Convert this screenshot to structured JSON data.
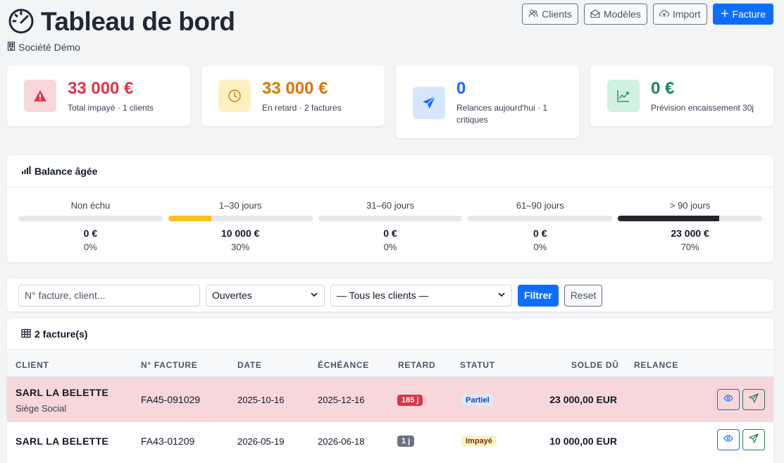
{
  "header": {
    "title": "Tableau de bord",
    "company": "Société Démo",
    "buttons": {
      "clients": "Clients",
      "templates": "Modèles",
      "import": "Import",
      "invoice": "Facture"
    }
  },
  "kpis": [
    {
      "value": "33 000 €",
      "label": "Total impayé · 1 clients",
      "color": "#dc3545",
      "icon": "warning-icon"
    },
    {
      "value": "33 000 €",
      "label": "En retard · 2 factures",
      "color": "#d97706",
      "icon": "clock-icon"
    },
    {
      "value": "0",
      "label": "Relances aujourd'hui · 1 critiques",
      "color": "#0d6efd",
      "icon": "send-icon"
    },
    {
      "value": "0 €",
      "label": "Prévision encaissement 30j",
      "color": "#198754",
      "icon": "trend-up-icon"
    }
  ],
  "aging": {
    "title": "Balance âgée",
    "buckets": [
      {
        "label": "Non échu",
        "amount": "0 €",
        "pct_label": "0%",
        "pct": 0,
        "color": "#e5e7eb"
      },
      {
        "label": "1–30 jours",
        "amount": "10 000 €",
        "pct_label": "30%",
        "pct": 30,
        "color": "#fbbf24"
      },
      {
        "label": "31–60 jours",
        "amount": "0 €",
        "pct_label": "0%",
        "pct": 0,
        "color": "#e5e7eb"
      },
      {
        "label": "61–90 jours",
        "amount": "0 €",
        "pct_label": "0%",
        "pct": 0,
        "color": "#e5e7eb"
      },
      {
        "label": "> 90 jours",
        "amount": "23 000 €",
        "pct_label": "70%",
        "pct": 70,
        "color": "#212529"
      }
    ]
  },
  "filters": {
    "search_placeholder": "N° facture, client...",
    "status_value": "Ouvertes",
    "client_value": "— Tous les clients —",
    "filter_label": "Filtrer",
    "reset_label": "Reset"
  },
  "table": {
    "title": "2 facture(s)",
    "headers": [
      "CLIENT",
      "N° FACTURE",
      "DATE",
      "ÉCHÉANCE",
      "RETARD",
      "STATUT",
      "SOLDE DÛ",
      "RELANCE"
    ],
    "rows": [
      {
        "client": "SARL LA BELETTE",
        "sub": "Siège Social",
        "invoice": "FA45-091029",
        "date": "2025-10-16",
        "due": "2025-12-16",
        "late": "185 j",
        "status": "Partiel",
        "balance": "23 000,00 EUR"
      },
      {
        "client": "SARL LA BELETTE",
        "sub": "",
        "invoice": "FA43-01209",
        "date": "2026-05-19",
        "due": "2026-06-18",
        "late": "1 j",
        "status": "Impayé",
        "balance": "10 000,00 EUR"
      }
    ]
  }
}
